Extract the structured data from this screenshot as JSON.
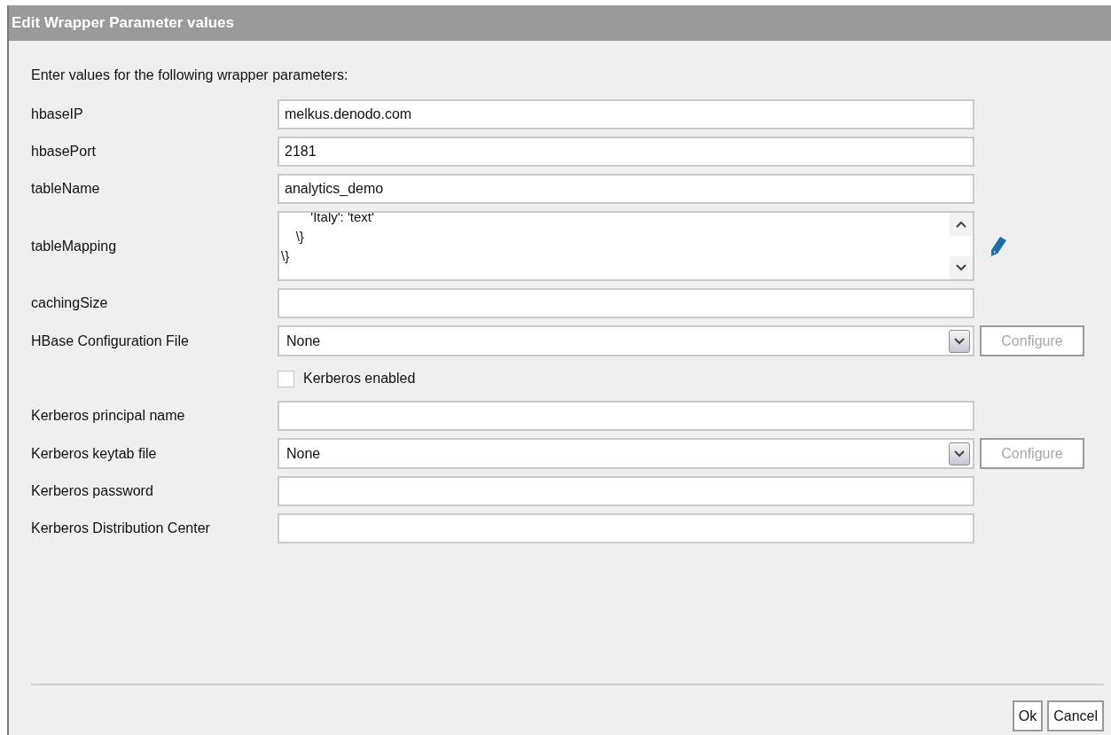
{
  "dialog": {
    "title": "Edit Wrapper Parameter values",
    "intro": "Enter values for the following wrapper parameters:",
    "params": [
      {
        "kind": "text",
        "label": "hbaseIP",
        "value": "melkus.denodo.com"
      },
      {
        "kind": "text",
        "label": "hbasePort",
        "value": "2181"
      },
      {
        "kind": "text",
        "label": "tableName",
        "value": "analytics_demo"
      },
      {
        "kind": "textarea",
        "label": "tableMapping",
        "lines": [
          "        'Italy': 'text'",
          "    \\}",
          "\\}"
        ]
      },
      {
        "kind": "text",
        "label": "cachingSize"
      },
      {
        "kind": "select",
        "label": "HBase Configuration File",
        "value": "None",
        "button": {
          "label": "Configure",
          "disabled": true
        }
      },
      {
        "kind": "checkbox",
        "label": "Kerberos enabled",
        "checked": false
      },
      {
        "kind": "text",
        "label": "Kerberos principal name"
      },
      {
        "kind": "select",
        "label": "Kerberos keytab file",
        "value": "None",
        "button": {
          "label": "Configure",
          "disabled": true
        }
      },
      {
        "kind": "text",
        "label": "Kerberos password"
      },
      {
        "kind": "text",
        "label": "Kerberos Distribution Center"
      }
    ],
    "buttons": [
      "Ok",
      "Cancel"
    ]
  }
}
